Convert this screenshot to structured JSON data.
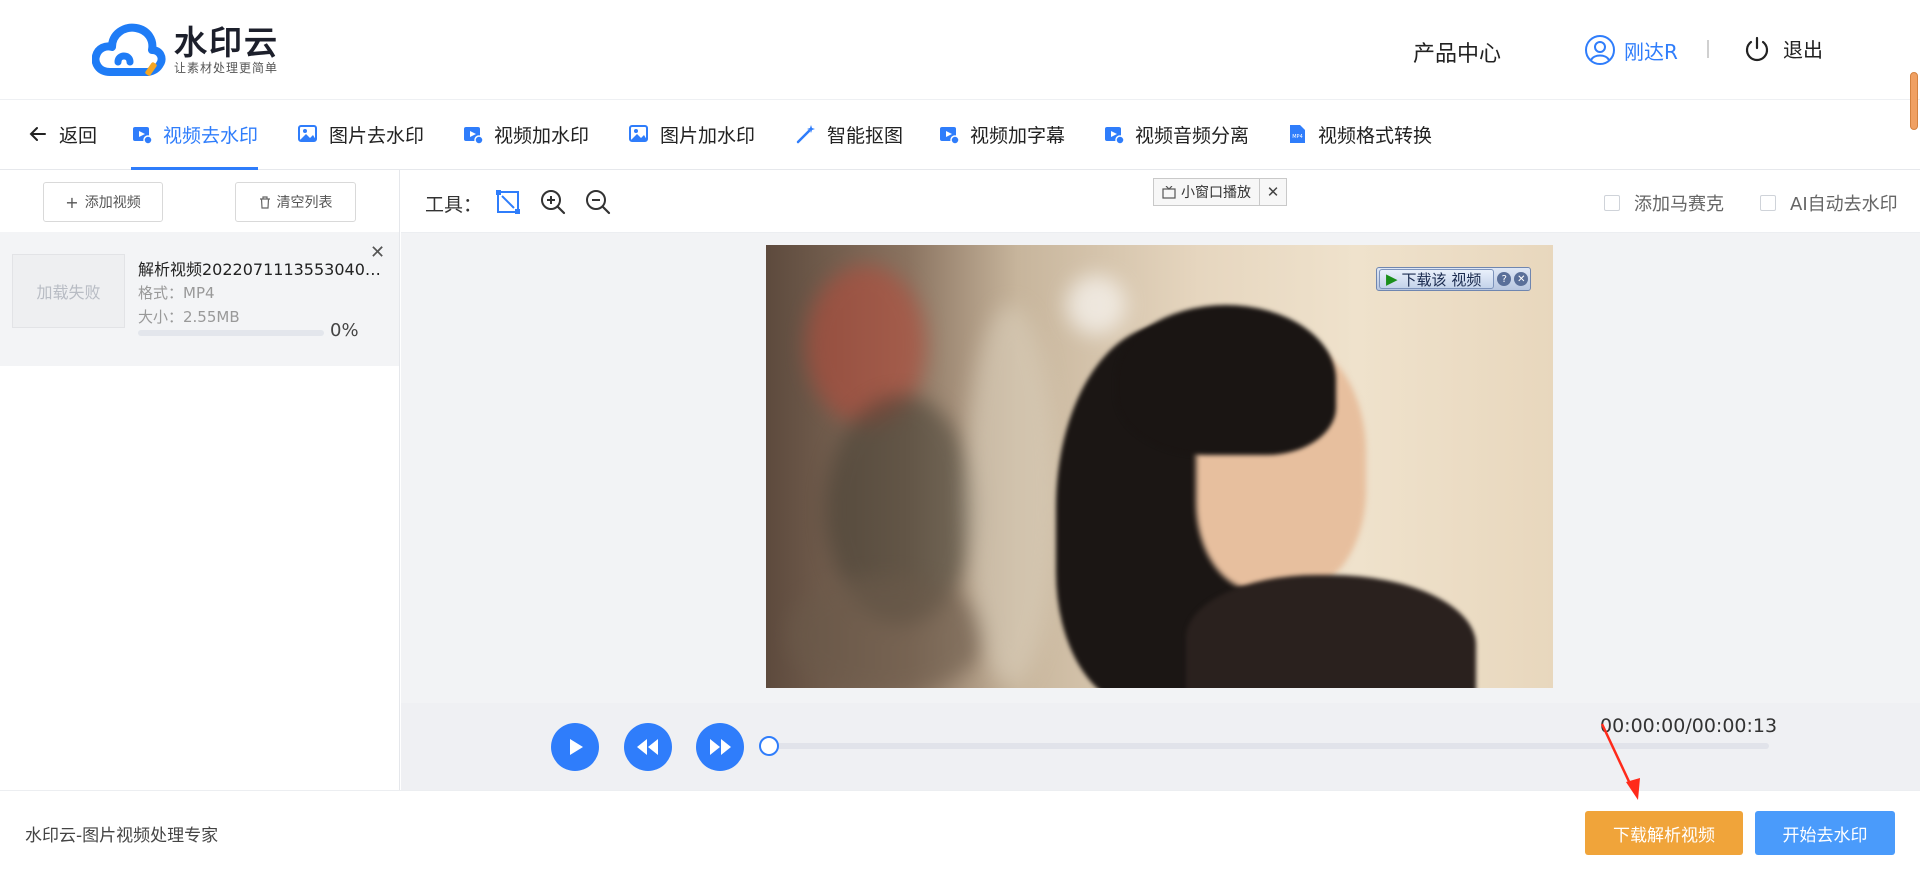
{
  "app": {
    "logo_name": "水印云",
    "logo_slogan": "让素材处理更简单",
    "nav_product": "产品中心",
    "user_name": "刚达R",
    "logout": "退出"
  },
  "tabs": [
    {
      "label": "返回",
      "icon": "arrow-left-icon"
    },
    {
      "label": "视频去水印",
      "icon": "video-icon",
      "active": true
    },
    {
      "label": "图片去水印",
      "icon": "image-icon"
    },
    {
      "label": "视频加水印",
      "icon": "video-icon"
    },
    {
      "label": "图片加水印",
      "icon": "image-icon"
    },
    {
      "label": "智能抠图",
      "icon": "magic-wand-icon"
    },
    {
      "label": "视频加字幕",
      "icon": "video-icon"
    },
    {
      "label": "视频音频分离",
      "icon": "video-icon"
    },
    {
      "label": "视频格式转换",
      "icon": "mp4-file-icon"
    }
  ],
  "left_panel": {
    "add_video": "添加视频",
    "clear_list": "清空列表",
    "file": {
      "thumb_status": "加载失败",
      "name": "解析视频20220711135530402...",
      "format": "格式：MP4",
      "size": "大小：2.55MB",
      "progress": "0%",
      "progress_value": 0
    }
  },
  "toolbar": {
    "label": "工具：",
    "mosaic": "添加马赛克",
    "ai_remove": "AI自动去水印"
  },
  "video_overlays": {
    "pip": "小窗口播放",
    "download": "下载该 视频"
  },
  "player": {
    "time": "00:00:00/00:00:13",
    "position": 0
  },
  "footer": {
    "text": "水印云-图片视频处理专家",
    "download_btn": "下载解析视频",
    "start_btn": "开始去水印"
  },
  "colors": {
    "accent": "#2f7dfb",
    "download_btn": "#f0a43a",
    "start_btn": "#4a9bfb"
  }
}
